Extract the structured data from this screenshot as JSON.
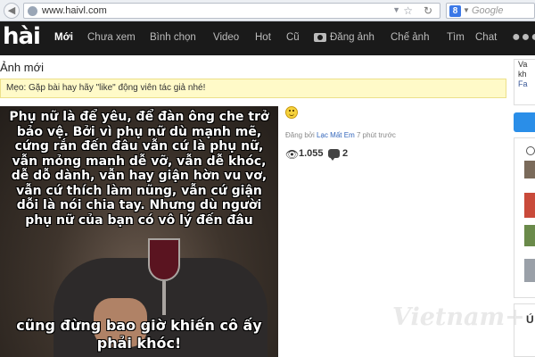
{
  "browser": {
    "url": "www.haivl.com",
    "search_placeholder": "Google",
    "search_engine_icon": "google-icon"
  },
  "site": {
    "logo": "hài",
    "nav": [
      "Mới",
      "Chưa xem",
      "Bình chọn",
      "Video",
      "Hot",
      "Cũ",
      "Đăng ảnh",
      "Chế ảnh",
      "Tìm",
      "Chat"
    ],
    "active_nav": "Mới"
  },
  "page": {
    "title": "Ảnh mới",
    "tip_label": "Mẹo:",
    "tip_text": " Gặp bài hay hãy \"like\" động viên tác giả nhé!"
  },
  "post": {
    "caption_top": "Phụ nữ là để yêu, để đàn ông che trở bảo vệ. Bởi vì phụ nữ dù mạnh mẽ, cứng rắn đến đâu vẫn cứ là phụ nữ, vẫn mỏng manh dễ vỡ, vẫn dễ khóc, dễ dỗ dành, vẫn hay giận hờn vu vơ, vẫn cứ thích làm nũng, vẫn cứ giận dỗi là nói chia tay. Nhưng dù người phụ nữ của bạn có vô lý đến đâu",
    "caption_bottom": "cũng đừng bao giờ khiến cô ấy phải khóc!",
    "watermark": "Vietnam+",
    "posted_by_prefix": "Đăng bởi ",
    "author": "Lạc Mất Em",
    "time_ago": " 7 phút trước",
    "views": "1.055",
    "comments": "2"
  },
  "sidebar": {
    "lines": [
      "Va",
      "kh",
      "Fa"
    ],
    "section_initial": "Ú"
  },
  "colors": {
    "header_bg": "#1a1a1a",
    "tip_bg": "#fffac8",
    "link": "#3366bb",
    "side_button": "#2a8ee8"
  }
}
